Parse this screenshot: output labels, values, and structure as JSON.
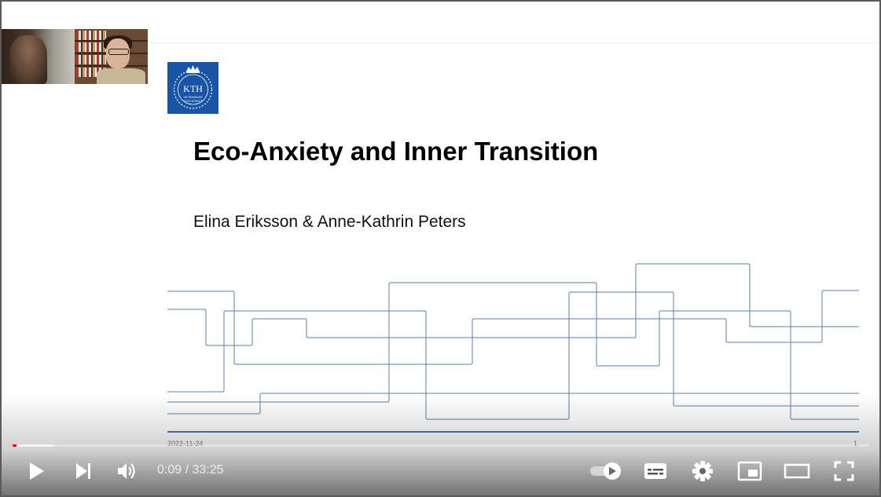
{
  "slide": {
    "title": "Eco-Anxiety and Inner Transition",
    "authors": "Elina Eriksson & Anne-Kathrin Peters",
    "date": "2022-11-24",
    "page_number": "1",
    "logo": {
      "name": "KTH",
      "subtext": "VETENSKAP OCH KONST",
      "color": "#1954a6"
    },
    "line_color": "#5a7fa8"
  },
  "player": {
    "current_time": "0:09",
    "separator": "/",
    "duration": "33:25",
    "progress_fraction": 0.0045,
    "buffered_fraction": 0.048,
    "accent_color": "#ff0000",
    "controls": {
      "play_icon": "play-icon",
      "next_icon": "next-icon",
      "volume_icon": "volume-icon",
      "autoplay_icon": "autoplay-toggle-icon",
      "subtitles_icon": "subtitles-icon",
      "settings_icon": "gear-icon",
      "miniplayer_icon": "miniplayer-icon",
      "theater_icon": "theater-mode-icon",
      "fullscreen_icon": "fullscreen-icon"
    }
  }
}
